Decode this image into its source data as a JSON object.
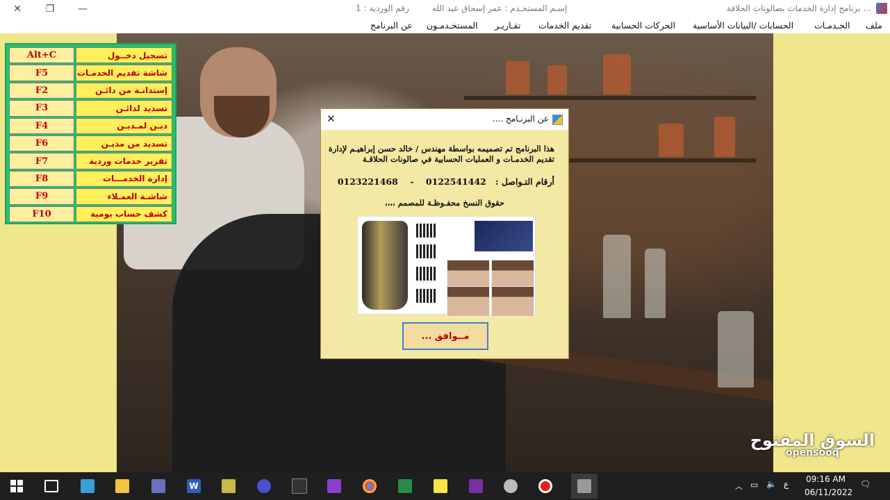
{
  "window": {
    "title": "برنامج إدارة الخدمات بصالونات الحلاقة ...",
    "user_label": "إسـم المستخـدم : عمر إسحاق عبد الله",
    "shift_label": "رقم الوردية :  1",
    "min_icon": "minimize-icon",
    "max_icon": "restore-icon",
    "close_icon": "close-icon"
  },
  "menu": [
    "ملف",
    "الخـدمـات",
    "الحسابات /البيانات الأساسية",
    "الحركات الحسابية",
    "تقديم الخدمات",
    "تقـاريـر",
    "المستخـدمـون",
    "عن البرنامج"
  ],
  "shortcuts": [
    {
      "label": "تسجيل دخــول",
      "key": "Alt+C"
    },
    {
      "label": "شاشة تقديم الخدمـات",
      "key": "F5"
    },
    {
      "label": "إستدانـة من دائـن",
      "key": "F2"
    },
    {
      "label": "تسديد لدائـن",
      "key": "F3"
    },
    {
      "label": "ديـن لمـديـن",
      "key": "F4"
    },
    {
      "label": "تسديد من مديـن",
      "key": "F6"
    },
    {
      "label": "تقرير خدمات وردية",
      "key": "F7"
    },
    {
      "label": "إدارة الخدمـــات",
      "key": "F8"
    },
    {
      "label": "شاشـة العمـلاء",
      "key": "F9"
    },
    {
      "label": "كشف حساب يومية",
      "key": "F10"
    }
  ],
  "dialog": {
    "title": "عن البرنـامج ....",
    "line1": "هذا البرنامج تم تصميمه بواسطة مهندس / خالد حسن إبراهيـم لإدارة",
    "line2": "تقديم الخدمـات و العمليات الحسابية في صالونات الحلاقـة",
    "contact_label": "أرقام التـواصل :",
    "phone1": "0122541442",
    "separator": "-",
    "phone2": "0123221468",
    "rights": "حقوق النسخ محفـوظـة للمصمم ،،،،",
    "ok_label": "مــوافق ..."
  },
  "watermark": {
    "arabic": "السوق المفتوح",
    "english": "opensooq"
  },
  "taskbar": {
    "apps": [
      "start-icon",
      "task-view-icon",
      "remote-desktop-icon",
      "file-explorer-icon",
      "visual-studio-code-icon",
      "word-icon",
      "access-tools-icon",
      "dotnet-icon",
      "terminal-icon",
      "visual-studio-icon",
      "chrome-icon",
      "excel-icon",
      "sticky-notes-icon",
      "onenote-icon",
      "media-icon",
      "record-icon",
      "photo-app-icon"
    ],
    "language": "ع",
    "time": "09:16 AM",
    "date": "06/11/2022"
  }
}
